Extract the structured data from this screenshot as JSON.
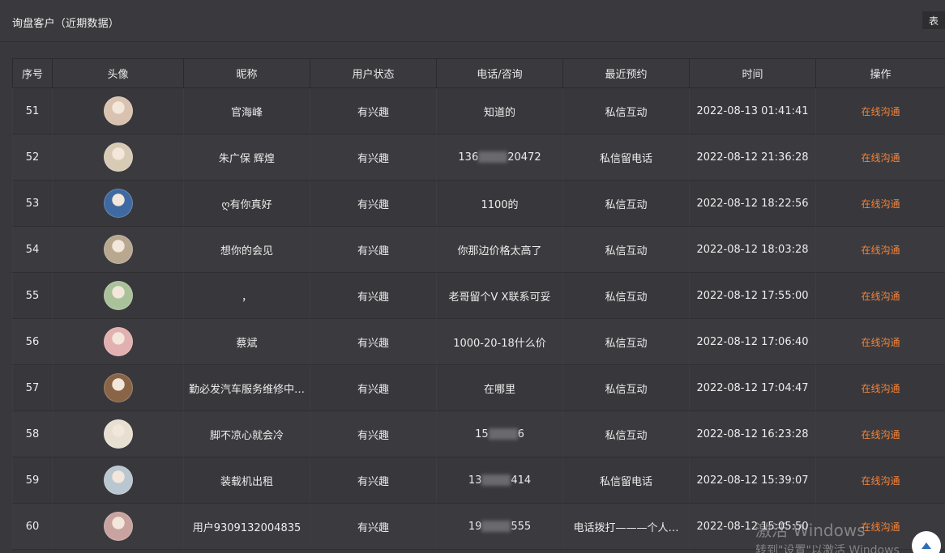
{
  "header": {
    "title": "询盘客户（近期数据）",
    "corner_label": "表"
  },
  "table": {
    "columns": [
      "序号",
      "头像",
      "昵称",
      "用户状态",
      "电话/咨询",
      "最近预约",
      "时间",
      "操作"
    ],
    "rows": [
      {
        "no": "51",
        "avatar_color": "#d9c2b0",
        "nickname": "官海峰",
        "status": "有兴趣",
        "phone_pre": "知道的",
        "phone_post": "",
        "masked": false,
        "booking": "私信互动",
        "time": "2022-08-13 01:41:41",
        "action": "在线沟通"
      },
      {
        "no": "52",
        "avatar_color": "#d8cbb6",
        "nickname": "朱广保 辉煌",
        "status": "有兴趣",
        "phone_pre": "136",
        "phone_post": "20472",
        "masked": true,
        "booking": "私信留电话",
        "time": "2022-08-12 21:36:28",
        "action": "在线沟通"
      },
      {
        "no": "53",
        "avatar_color": "#3f6aa1",
        "nickname": "ღ有你真好",
        "status": "有兴趣",
        "phone_pre": "1100的",
        "phone_post": "",
        "masked": false,
        "booking": "私信互动",
        "time": "2022-08-12 18:22:56",
        "action": "在线沟通"
      },
      {
        "no": "54",
        "avatar_color": "#b7a88f",
        "nickname": "想你的会见",
        "status": "有兴趣",
        "phone_pre": "你那边价格太高了",
        "phone_post": "",
        "masked": false,
        "booking": "私信互动",
        "time": "2022-08-12 18:03:28",
        "action": "在线沟通"
      },
      {
        "no": "55",
        "avatar_color": "#a9c29a",
        "nickname": "，",
        "status": "有兴趣",
        "phone_pre": "老哥留个V X联系可妥",
        "phone_post": "",
        "masked": false,
        "booking": "私信互动",
        "time": "2022-08-12 17:55:00",
        "action": "在线沟通"
      },
      {
        "no": "56",
        "avatar_color": "#e2b0b0",
        "nickname": "蔡斌",
        "status": "有兴趣",
        "phone_pre": "1000-20-18什么价",
        "phone_post": "",
        "masked": false,
        "booking": "私信互动",
        "time": "2022-08-12 17:06:40",
        "action": "在线沟通"
      },
      {
        "no": "57",
        "avatar_color": "#8a6446",
        "nickname": "勤必发汽车服务维修中…",
        "status": "有兴趣",
        "phone_pre": "在哪里",
        "phone_post": "",
        "masked": false,
        "booking": "私信互动",
        "time": "2022-08-12 17:04:47",
        "action": "在线沟通"
      },
      {
        "no": "58",
        "avatar_color": "#e7e0d2",
        "nickname": "脚不凉心就会冷",
        "status": "有兴趣",
        "phone_pre": "15",
        "phone_post": "6",
        "masked": true,
        "booking": "私信互动",
        "time": "2022-08-12 16:23:28",
        "action": "在线沟通"
      },
      {
        "no": "59",
        "avatar_color": "#b9c7d1",
        "nickname": "装载机出租",
        "status": "有兴趣",
        "phone_pre": "13",
        "phone_post": "414",
        "masked": true,
        "booking": "私信留电话",
        "time": "2022-08-12 15:39:07",
        "action": "在线沟通"
      },
      {
        "no": "60",
        "avatar_color": "#c8a3a0",
        "nickname": "用户9309132004835",
        "status": "有兴趣",
        "phone_pre": "19",
        "phone_post": "555",
        "masked": true,
        "booking": "电话拨打———个人…",
        "time": "2022-08-12 15:05:50",
        "action": "在线沟通"
      }
    ]
  },
  "watermark": {
    "line1": "激活 Windows",
    "line2": "转到\"设置\"以激活 Windows"
  },
  "colors": {
    "background": "#39393d",
    "action_link": "#f5833a"
  }
}
